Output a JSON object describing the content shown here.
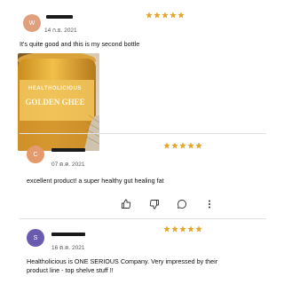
{
  "reviews": [
    {
      "avatar_initial": "W",
      "avatar_color": "#e0a07e",
      "date": "14 ก.ย. 2021",
      "rating": 5,
      "text": "It's quite good and this is my second bottle",
      "photo_label_top": "HEALTHOLICIOUS",
      "photo_label_main": "GOLDEN GHEE"
    },
    {
      "avatar_initial": "C",
      "avatar_color": "#e59a6c",
      "date": "07 ต.ค. 2021",
      "rating": 5,
      "text": "excellent product! a super healthy gut healing fat"
    },
    {
      "avatar_initial": "S",
      "avatar_color": "#6b5bb0",
      "date": "16 ต.ค. 2021",
      "rating": 5,
      "text": "Healtholicious is ONE SERIOUS Company.  Very impressed by their product line - top shelve stuff !!"
    }
  ],
  "actions": {
    "icons": [
      "thumbs-up-icon",
      "thumbs-down-icon",
      "comment-icon",
      "more-vertical-icon"
    ]
  },
  "colors": {
    "star": "#e6a42a",
    "divider": "#e3e3e3",
    "ghee_gold": "#e2a82e"
  }
}
